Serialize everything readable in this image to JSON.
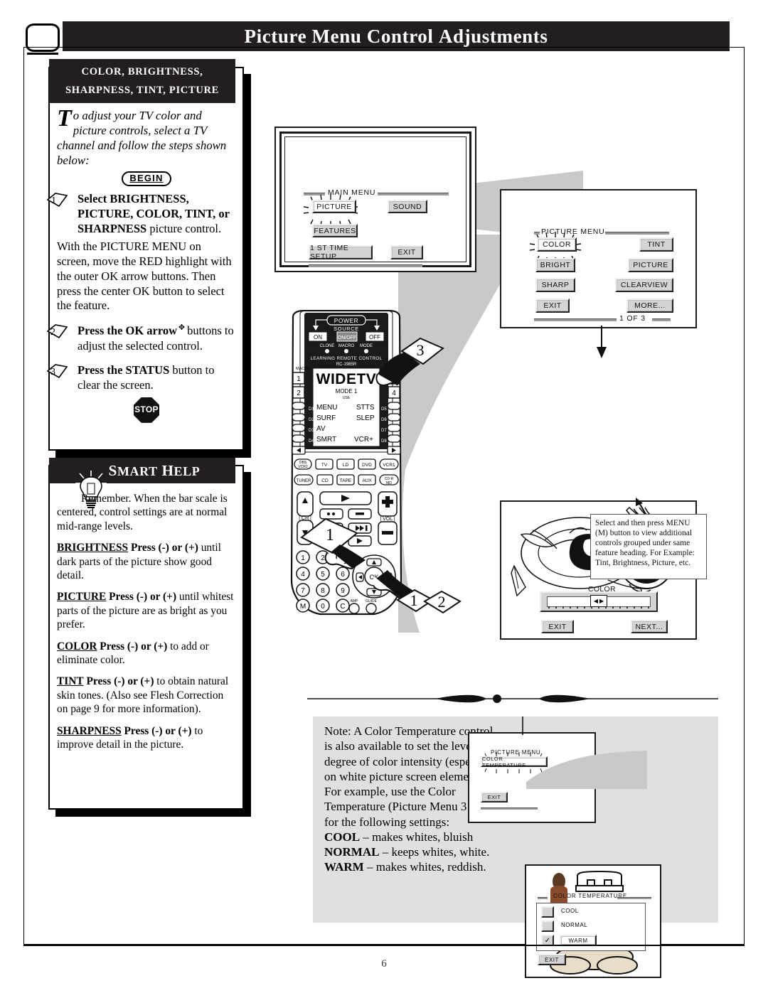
{
  "header": {
    "title_words": [
      "Picture",
      "Menu",
      "Control",
      "Adjustments"
    ],
    "tv_icon": "tv-icon"
  },
  "intro_box": {
    "title_line1": "COLOR, BRIGHTNESS,",
    "title_line2": "SHARPNESS, TINT, PICTURE",
    "dropcap": "T",
    "intro_text": "o adjust your TV color and picture controls, select a TV channel and follow the steps shown below:",
    "begin_label": "BEGIN",
    "steps": [
      {
        "number": "1",
        "bold_lead": "Select BRIGHTNESS, PICTURE, COLOR, TINT, or SHARPNESS",
        "rest": " picture control."
      },
      {
        "number": "2",
        "bold_lead": "Press the OK arrow",
        "rest": " buttons to adjust the selected control."
      },
      {
        "number": "3",
        "bold_lead": "Press the STATUS",
        "rest": " button to clear the screen."
      }
    ],
    "step1_para": "With the PICTURE MENU on screen, move the RED highlight with the outer OK arrow buttons. Then press the center OK button to select the feature.",
    "stop_label": "STOP"
  },
  "smart_help": {
    "title": "Smart Help",
    "title_words": [
      "S",
      "MART",
      " H",
      "ELP"
    ],
    "paragraphs": [
      "Remember. When the bar scale is centered, control settings are at normal mid-range levels."
    ],
    "entries": [
      {
        "kw": "BRIGHTNESS",
        "bold": "Press (-) or (+)",
        "text": " until dark parts of the picture show good detail."
      },
      {
        "kw": "PICTURE",
        "bold": "Press (-) or (+)",
        "text": " until whitest parts of the picture are as bright as you prefer."
      },
      {
        "kw": "COLOR",
        "bold": "Press (-) or (+)",
        "text": " to add or eliminate color."
      },
      {
        "kw": "TINT",
        "bold": "Press (-) or (+)",
        "text": " to obtain natural skin tones.  (Also see Flesh Correction on page 9 for more information)."
      },
      {
        "kw": "SHARPNESS",
        "bold": "Press (-) or (+)",
        "text": " to improve detail in the picture."
      }
    ]
  },
  "main_menu_screen": {
    "title": "MAIN MENU",
    "buttons": [
      {
        "label": "PICTURE",
        "highlighted": true
      },
      {
        "label": "SOUND",
        "highlighted": false
      },
      {
        "label": "FEATURES",
        "highlighted": false
      },
      {
        "label": "1 ST TIME SETUP",
        "highlighted": false
      },
      {
        "label": "EXIT",
        "highlighted": false
      }
    ]
  },
  "picture_menu_screen": {
    "title": "PICTURE MENU",
    "page_indicator": "1 OF 3",
    "buttons": [
      {
        "label": "COLOR",
        "highlighted": true
      },
      {
        "label": "TINT",
        "highlighted": false
      },
      {
        "label": "BRIGHT",
        "highlighted": false
      },
      {
        "label": "PICTURE",
        "highlighted": false
      },
      {
        "label": "SHARP",
        "highlighted": false
      },
      {
        "label": "CLEARVIEW",
        "highlighted": false
      },
      {
        "label": "EXIT",
        "highlighted": false
      },
      {
        "label": "MORE...",
        "highlighted": false
      }
    ]
  },
  "color_adjust_screen": {
    "bar_label": "COLOR",
    "exit_label": "EXIT",
    "next_label": "NEXT..."
  },
  "menu_note": {
    "text": "Select and then press MENU (M) button to view additional controls grouped under same feature heading. For Example: Tint, Brightness, Picture, etc."
  },
  "bottom_note": {
    "text": "Note: A Color Temperature control is also available to set the level or degree of color intensity (especially on white picture screen elements). For example, use the Color Temperature (Picture Menu 3 of 3) for the following settings:",
    "settings": [
      {
        "name": "COOL",
        "desc": " – makes whites, bluish"
      },
      {
        "name": "NORMAL",
        "desc": " – keeps whites, white."
      },
      {
        "name": "WARM",
        "desc": " – makes whites, reddish."
      }
    ]
  },
  "color_temp_menu": {
    "parent_title": "PICTURE MENU",
    "parent_button": "COLOR TEMPERATURE",
    "parent_exit": "EXIT",
    "title": "COLOR TEMPERATURE",
    "options": [
      {
        "label": "COOL",
        "checked": false
      },
      {
        "label": "NORMAL",
        "checked": false
      },
      {
        "label": "WARM",
        "checked": true
      }
    ],
    "exit_label": "EXIT"
  },
  "remote": {
    "power_label": "POWER",
    "source_label": "SOURCE",
    "on_label": "ON",
    "onoff_label": "ON/OFF",
    "off_label": "OFF",
    "leds": [
      "CLONE",
      "MACRO",
      "MODE"
    ],
    "brand_line1": "LEARNING REMOTE CONTROL",
    "brand_line2": "RC-1985R",
    "lcd_title": "WIDETV",
    "lcd_mode": "MODE  1",
    "lcd_use": "USE",
    "lcd_keys_left": [
      "MENU",
      "SURF",
      "AV",
      "SMRT"
    ],
    "lcd_keys_right": [
      "STTS",
      "SLEP",
      "",
      "VCR+"
    ],
    "lcd_tags_left": [
      "D1",
      "D2",
      "D3",
      "D4"
    ],
    "lcd_tags_right": [
      "D5",
      "D6",
      "D7",
      "D8"
    ],
    "macro_label": "MACRO",
    "side_keys_left": [
      "1",
      "2"
    ],
    "side_keys_right": [
      "3",
      "4"
    ],
    "device_row1": [
      "DBS/VCR2",
      "TV",
      "LD",
      "DVD",
      "VCR1"
    ],
    "device_row2": [
      "TUNER",
      "CD",
      "TAPE",
      "AUX",
      "CD-R/MD"
    ],
    "ch_label": "CH",
    "vol_label": "VOL",
    "ok_label": "OK",
    "keypad": [
      "1",
      "2",
      "3",
      "4",
      "5",
      "6",
      "7",
      "8",
      "9",
      "M",
      "0",
      "C"
    ],
    "amp_label": "AMP",
    "guide_label": "GUIDE"
  },
  "callouts": [
    {
      "number": "3"
    },
    {
      "number": "1"
    },
    {
      "number": "1"
    },
    {
      "number": "2"
    }
  ],
  "footer": {
    "page_number": "6"
  },
  "colors": {
    "ink": "#231f1f",
    "gray_swoosh": "#c9c9c9",
    "button_face": "#d4d4d4",
    "panel_gray": "#e0e0e0"
  }
}
